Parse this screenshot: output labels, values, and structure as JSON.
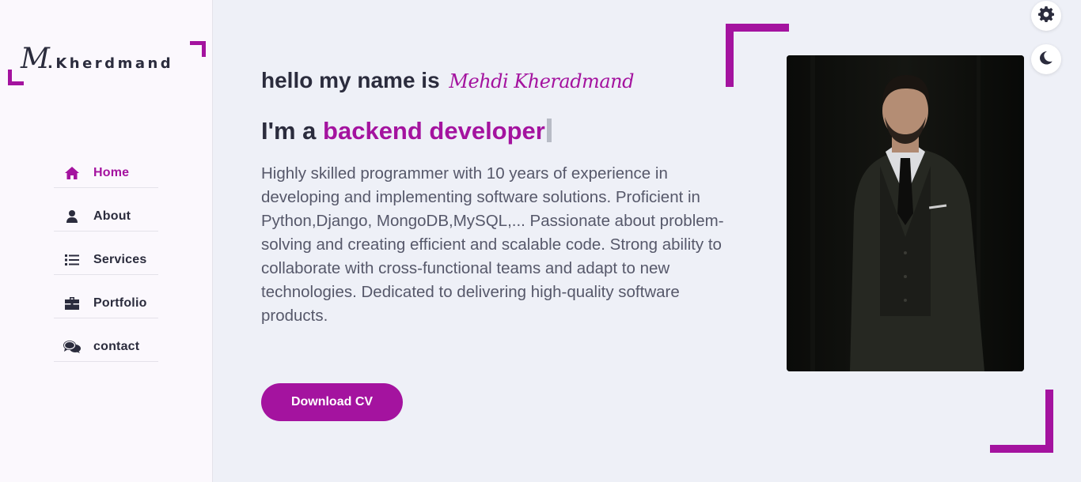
{
  "logo": {
    "initial": "M",
    "text": ".Kherdmand"
  },
  "nav": {
    "items": [
      {
        "label": "Home",
        "icon": "home-icon",
        "active": true
      },
      {
        "label": "About",
        "icon": "user-icon",
        "active": false
      },
      {
        "label": "Services",
        "icon": "list-icon",
        "active": false
      },
      {
        "label": "Portfolio",
        "icon": "briefcase-icon",
        "active": false
      },
      {
        "label": "contact",
        "icon": "comments-icon",
        "active": false
      }
    ]
  },
  "hero": {
    "greeting": "hello my name is",
    "name": "Mehdi Kheradmand",
    "role_prefix": "I'm a",
    "role": "backend developer",
    "bio": "Highly skilled programmer with 10 years of experience in developing and implementing software solutions. Proficient in Python,Django, MongoDB,MySQL,... Passionate about problem-solving and creating efficient and scalable code. Strong ability to collaborate with cross-functional teams and adapt to new technologies. Dedicated to delivering high-quality software products.",
    "cv_button": "Download CV"
  },
  "controls": {
    "settings_icon": "gear-icon",
    "theme_icon": "moon-icon"
  },
  "colors": {
    "accent": "#a4139f",
    "text": "#2b2c3d",
    "background": "#eef0f7",
    "sidebar": "#fbf8fd"
  }
}
